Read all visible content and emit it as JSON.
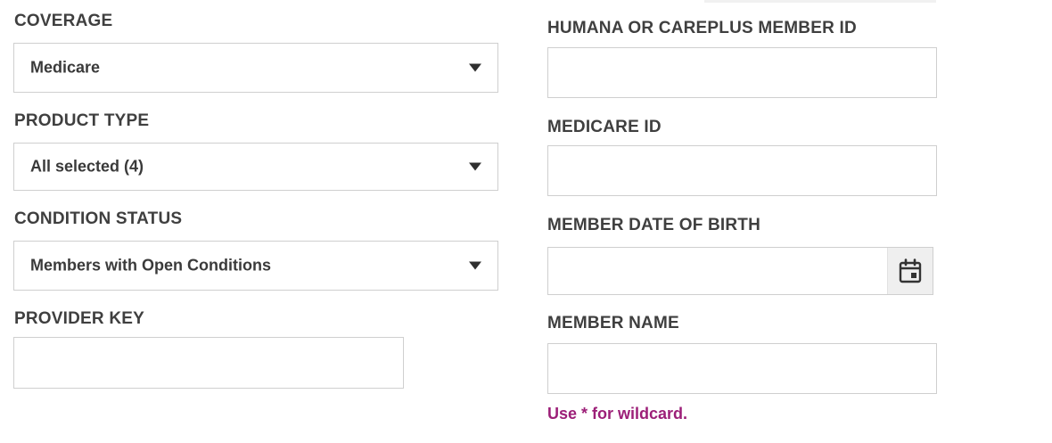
{
  "left_column": {
    "coverage": {
      "label": "COVERAGE",
      "value": "Medicare"
    },
    "product_type": {
      "label": "PRODUCT TYPE",
      "value": "All selected (4)"
    },
    "condition_status": {
      "label": "CONDITION STATUS",
      "value": "Members with Open Conditions"
    },
    "provider_key": {
      "label": "PROVIDER KEY",
      "value": ""
    }
  },
  "right_column": {
    "member_id": {
      "label": "HUMANA OR CAREPLUS MEMBER ID",
      "value": ""
    },
    "medicare_id": {
      "label": "MEDICARE ID",
      "value": ""
    },
    "date_of_birth": {
      "label": "MEMBER DATE OF BIRTH",
      "value": "",
      "icon": "calendar-icon"
    },
    "member_name": {
      "label": "MEMBER NAME",
      "value": "",
      "hint": "Use * for wildcard."
    }
  },
  "colors": {
    "label_text": "#3f3f3f",
    "field_border": "#cfcfcf",
    "hint_text": "#9c1f78",
    "calendar_button_bg": "#efefef"
  },
  "icons": {
    "dropdown": "chevron-down-icon",
    "date": "calendar-icon"
  }
}
